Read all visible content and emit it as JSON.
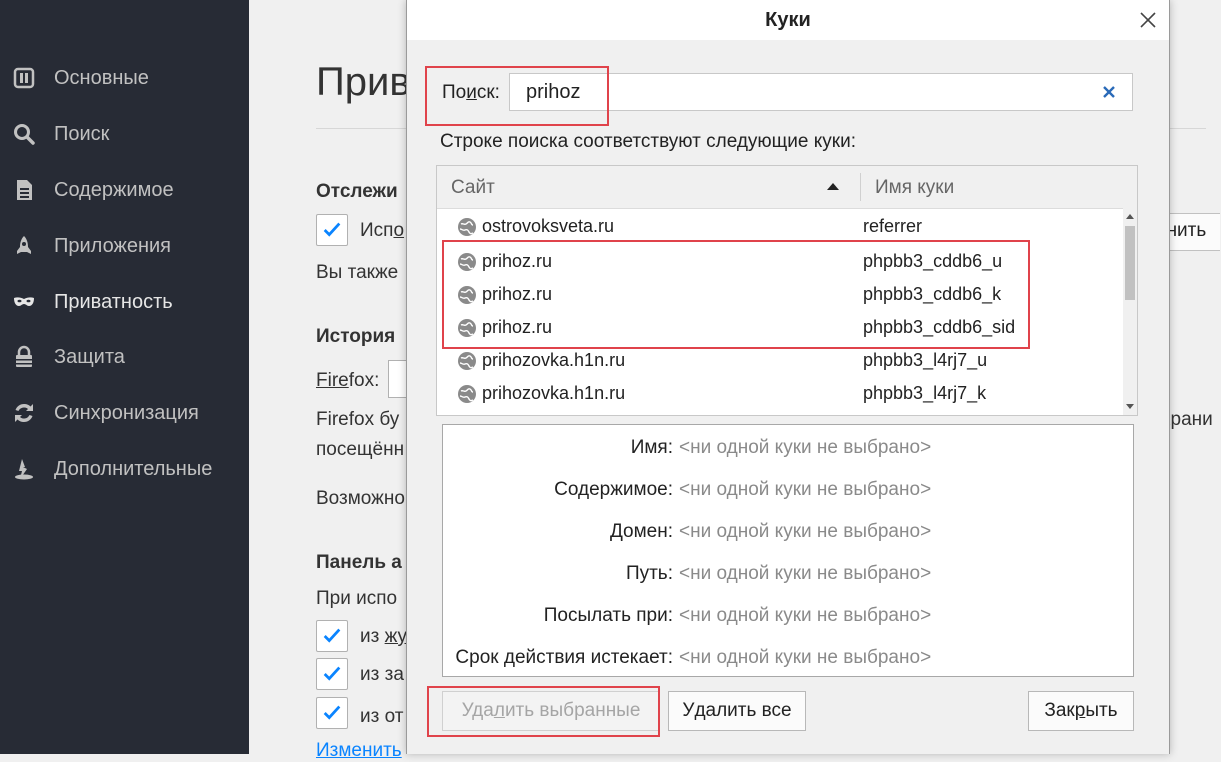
{
  "sidebar": {
    "items": [
      {
        "label": "Основные",
        "icon": "general-icon"
      },
      {
        "label": "Поиск",
        "icon": "search-icon"
      },
      {
        "label": "Содержимое",
        "icon": "content-icon"
      },
      {
        "label": "Приложения",
        "icon": "applications-icon"
      },
      {
        "label": "Приватность",
        "icon": "privacy-mask-icon"
      },
      {
        "label": "Защита",
        "icon": "security-icon"
      },
      {
        "label": "Синхронизация",
        "icon": "sync-icon"
      },
      {
        "label": "Дополнительные",
        "icon": "advanced-icon"
      }
    ]
  },
  "background": {
    "title": "Прив",
    "tracking_heading": "Отслежи",
    "tracking_check_label": "Исп",
    "tracking_check_label_rest": "о",
    "also_text": "Вы также",
    "manage_button_fragment": "енить",
    "history_heading": "История",
    "firefox_label": "Fire",
    "firefox_label_rest": "fox:",
    "firefox_will_text": "Firefox бу",
    "visited_text": "посещённ",
    "save_fragment": "храни",
    "possible_text": "Возможно",
    "address_bar_heading": "Панель а",
    "when_using_text": "При испо",
    "checks": [
      {
        "label": "из ",
        "label_underlined": "жу"
      },
      {
        "label": "из за"
      },
      {
        "label": "из от"
      }
    ],
    "change_link": "Изменить"
  },
  "dialog": {
    "title": "Куки",
    "search_label_prefix": "По",
    "search_label_accesskey": "и",
    "search_label_suffix": "ск:",
    "search_value": "prihoz",
    "match_text": "Строке поиска соответствуют следующие куки:",
    "columns": {
      "site": "Сайт",
      "name": "Имя куки",
      "sort": "ascending"
    },
    "rows": [
      {
        "site": "ostrovoksveta.ru",
        "name": "referrer"
      },
      {
        "site": "prihoz.ru",
        "name": "phpbb3_cddb6_u"
      },
      {
        "site": "prihoz.ru",
        "name": "phpbb3_cddb6_k"
      },
      {
        "site": "prihoz.ru",
        "name": "phpbb3_cddb6_sid"
      },
      {
        "site": "prihozovka.h1n.ru",
        "name": "phpbb3_l4rj7_u"
      },
      {
        "site": "prihozovka.h1n.ru",
        "name": "phpbb3_l4rj7_k"
      }
    ],
    "details": [
      {
        "label": "Имя:",
        "value": "<ни одной куки не выбрано>"
      },
      {
        "label": "Содержимое:",
        "value": "<ни одной куки не выбрано>"
      },
      {
        "label": "Домен:",
        "value": "<ни одной куки не выбрано>"
      },
      {
        "label": "Путь:",
        "value": "<ни одной куки не выбрано>"
      },
      {
        "label": "Посылать при:",
        "value": "<ни одной куки не выбрано>"
      },
      {
        "label": "Срок действия истекает:",
        "value": "<ни одной куки не выбрано>"
      }
    ],
    "buttons": {
      "remove_selected_a": "Уда",
      "remove_selected_key": "л",
      "remove_selected_b": "ить выбранные",
      "remove_all_a": "У",
      "remove_all_key": "д",
      "remove_all_b": "алить все",
      "close_a": "Зак",
      "close_key": "р",
      "close_b": "ыть"
    }
  },
  "colors": {
    "sidebar_bg": "#272b35",
    "highlight": "#e0434b",
    "check_blue": "#0a84ff"
  }
}
